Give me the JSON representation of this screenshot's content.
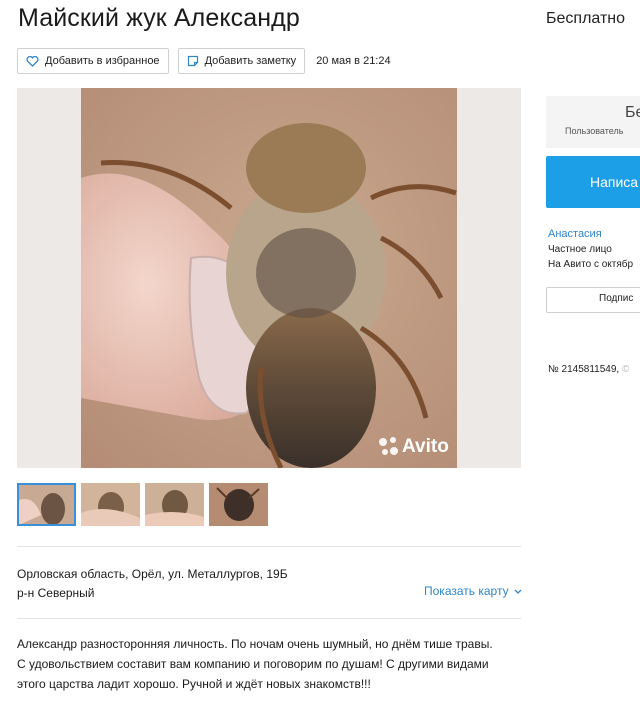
{
  "listing": {
    "title": "Майский жук Александр",
    "price": "Бесплатно",
    "add_favorite_label": "Добавить в избранное",
    "add_note_label": "Добавить заметку",
    "date": "20 мая в 21:24",
    "watermark": "Avito"
  },
  "thumbnails": [
    {
      "label": "photo-1",
      "active": true
    },
    {
      "label": "photo-2",
      "active": false
    },
    {
      "label": "photo-3",
      "active": false
    },
    {
      "label": "photo-4",
      "active": false
    }
  ],
  "location": {
    "address": "Орловская область, Орёл, ул. Металлургов, 19Б",
    "district": "р-н Северный",
    "show_map_label": "Показать карту"
  },
  "description": {
    "line1": "Александр разносторонняя личность. По ночам очень шумный, но днём тише травы.",
    "line2": "С удовольствием составит вам компанию и поговорим по душам! С другими видами",
    "line3": "этого царства ладит хорошо. Ручной и ждёт новых знакомств!!!"
  },
  "sidebar": {
    "card_big": "Бе",
    "card_small": "Пользователь",
    "write_button": "Написа",
    "seller_name": "Анастасия",
    "seller_type": "Частное лицо",
    "seller_since": "На Авито с октябр",
    "subscribe_button": "Подпис",
    "ad_number": "№ 2145811549,",
    "ad_number_tail": "©"
  },
  "colors": {
    "link": "#2f86c9",
    "primary_button": "#1d9fe8",
    "border": "#cfcfcf"
  }
}
